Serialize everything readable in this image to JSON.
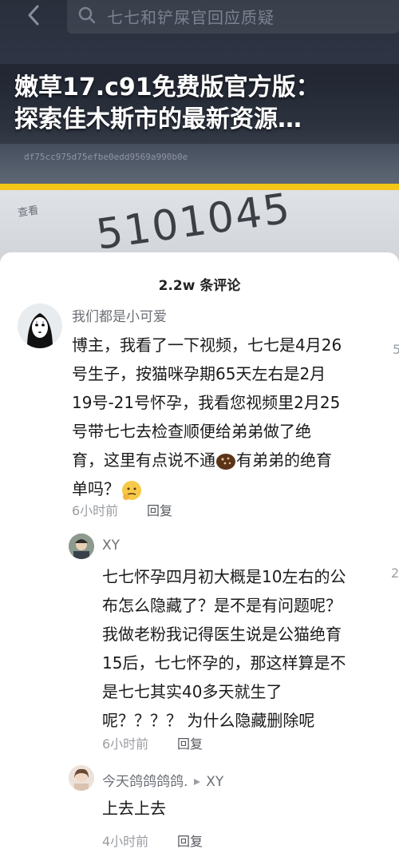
{
  "search": {
    "placeholder": "七七和铲屎官回应质疑"
  },
  "headline": {
    "line1": "嫩草17.c91免费版官方版：",
    "line2": "探索佳木斯市的最新资源…"
  },
  "background": {
    "hash_text": "df75cc975d75efbe0edd9569a990b0e",
    "view_label": "查看",
    "big_number": "5101045"
  },
  "sheet": {
    "title": "2.2w 条评论"
  },
  "comments": [
    {
      "user": "我们都是小可爱",
      "lines": [
        "博主，我看了一下视频，七七是4月26",
        "号生子，按猫咪孕期65天左右是2月",
        "19号-21号怀孕，我看您视频里2月25",
        "号带七七去检查顺便给弟弟做了绝",
        "育，这里有点说不通",
        "有弟弟的绝育",
        "单吗？"
      ],
      "time": "6小时前",
      "reply": "回复",
      "edge": "5"
    },
    {
      "user": "XY",
      "lines": [
        "七七怀孕四月初大概是10左右的公",
        "布怎么隐藏了？是不是有问题呢？",
        "我做老粉我记得医生说是公猫绝育",
        "15后，七七怀孕的，那这样算是不",
        "是七七其实40多天就生了",
        "呢？？？？ 为什么隐藏删除呢"
      ],
      "time": "6小时前",
      "reply": "回复",
      "edge": "2"
    },
    {
      "user": "今天鸽鸽鸽鸽.",
      "reply_to": "XY",
      "lines": [
        "上去上去"
      ],
      "time": "4小时前",
      "reply": "回复"
    }
  ],
  "colors": {
    "accent_stripe": "#f5c518",
    "sheet_bg": "#ffffff"
  }
}
